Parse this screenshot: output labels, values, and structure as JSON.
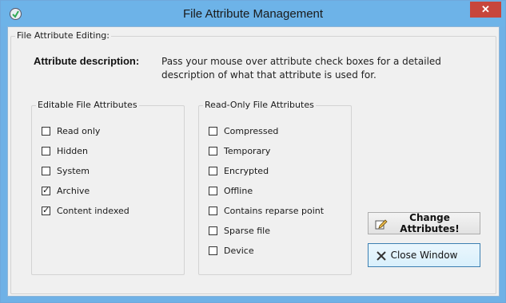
{
  "window": {
    "title": "File Attribute Management",
    "close_glyph": "✕"
  },
  "editing_group": {
    "label": "File Attribute Editing:"
  },
  "description": {
    "label": "Attribute description:",
    "text": "Pass your mouse over attribute check boxes for a detailed description of what that attribute is used for."
  },
  "editable": {
    "label": "Editable File Attributes",
    "items": [
      {
        "label": "Read only",
        "checked": false
      },
      {
        "label": "Hidden",
        "checked": false
      },
      {
        "label": "System",
        "checked": false
      },
      {
        "label": "Archive",
        "checked": true
      },
      {
        "label": "Content indexed",
        "checked": true
      }
    ]
  },
  "readonly": {
    "label": "Read-Only File Attributes",
    "items": [
      {
        "label": "Compressed",
        "checked": false
      },
      {
        "label": "Temporary",
        "checked": false
      },
      {
        "label": "Encrypted",
        "checked": false
      },
      {
        "label": "Offline",
        "checked": false
      },
      {
        "label": "Contains reparse point",
        "checked": false
      },
      {
        "label": "Sparse file",
        "checked": false
      },
      {
        "label": "Device",
        "checked": false
      }
    ]
  },
  "buttons": {
    "change": {
      "label": "Change Attributes!",
      "icon": "edit-icon"
    },
    "close": {
      "label": "Close Window",
      "icon": "close-icon"
    }
  }
}
